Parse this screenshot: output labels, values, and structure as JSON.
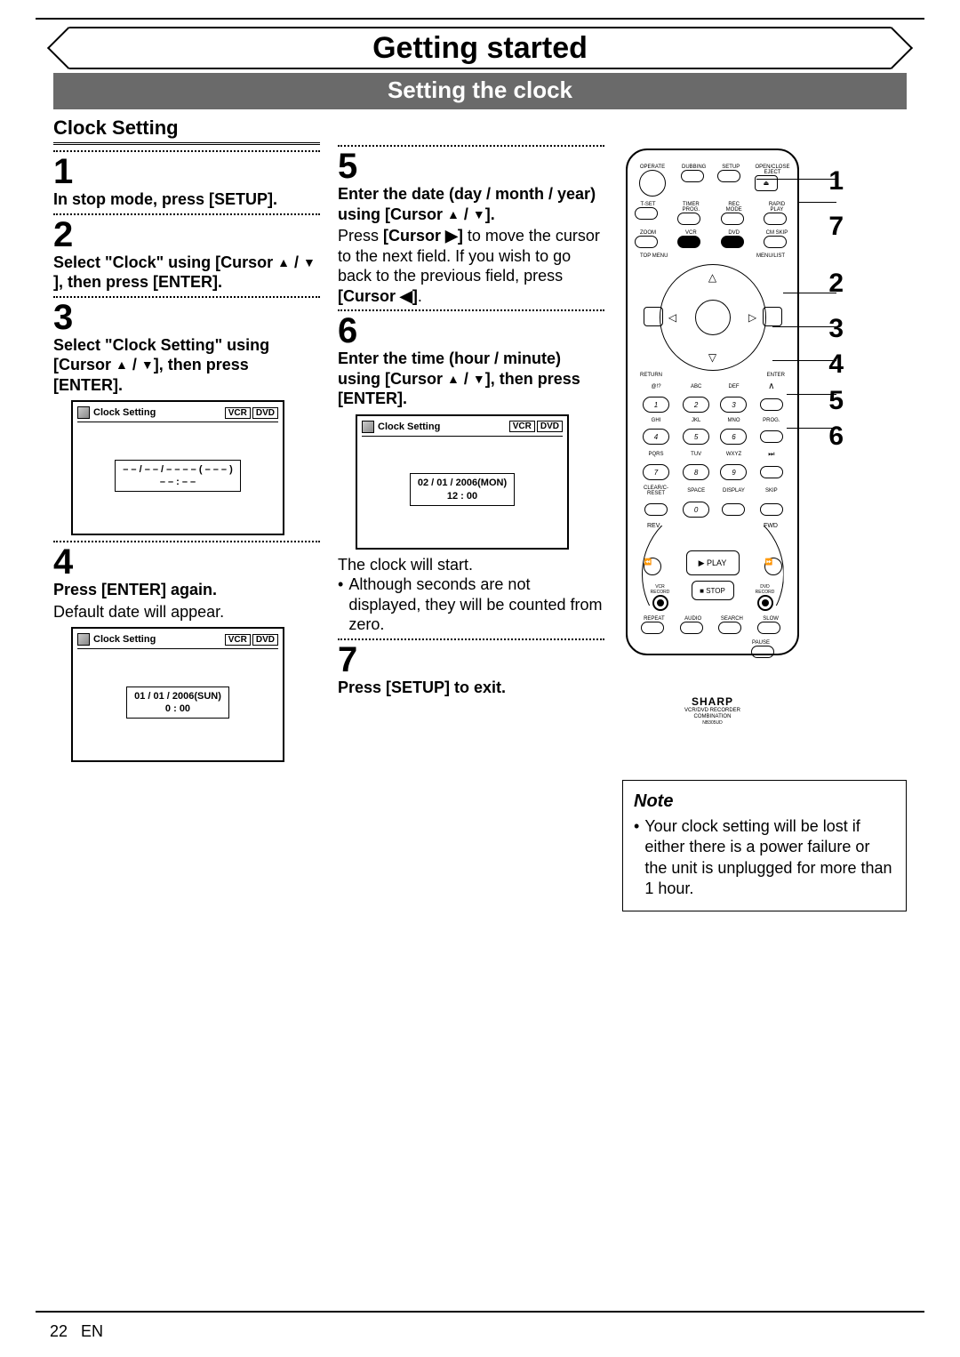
{
  "header": {
    "title": "Getting started",
    "subtitle": "Setting the clock"
  },
  "section_title": "Clock Setting",
  "steps": {
    "s1": {
      "num": "1",
      "bold": "In stop mode, press [SETUP]."
    },
    "s2": {
      "num": "2",
      "bold_a": "Select \"Clock\" using [Cursor ",
      "bold_b": "], then press [ENTER]."
    },
    "s3": {
      "num": "3",
      "bold_a": "Select \"Clock Setting\" using [Cursor ",
      "bold_b": "], then press [ENTER]."
    },
    "s4": {
      "num": "4",
      "bold": "Press [ENTER] again.",
      "body": "Default date will appear."
    },
    "s5": {
      "num": "5",
      "bold_a": "Enter the date (day / month / year) using [Cursor ",
      "bold_b": "].",
      "body_a": "Press ",
      "body_bold_a": "[Cursor ▶]",
      "body_b": " to move the cursor to the next field. If you wish to go back to the previous field, press ",
      "body_bold_b": "[Cursor ◀]",
      "body_c": "."
    },
    "s6": {
      "num": "6",
      "bold_a": "Enter the time (hour / minute) using [Cursor ",
      "bold_b": "], then press [ENTER].",
      "body_a": "The clock will start.",
      "bullet_a": "Although seconds are not displayed, they will be counted from zero."
    },
    "s7": {
      "num": "7",
      "bold": "Press [SETUP] to exit."
    }
  },
  "osd": {
    "title": "Clock Setting",
    "vcr": "VCR",
    "dvd": "DVD",
    "blank_date": "– –  /  – –  / – – – – ( – – – )",
    "blank_time": "– – : – –",
    "date4": "01 / 01 / 2006(SUN)",
    "time4": "0 : 00",
    "date6": "02 / 01 / 2006(MON)",
    "time6": "12 : 00"
  },
  "remote": {
    "row1": [
      "OPERATE",
      "DUBBING",
      "SETUP",
      "OPEN/CLOSE EJECT"
    ],
    "row2": [
      "T-SET",
      "TIMER PROG.",
      "REC MODE",
      "RAPID PLAY"
    ],
    "row3": [
      "ZOOM",
      "VCR",
      "DVD",
      "CM SKIP"
    ],
    "row4": [
      "TOP MENU",
      "",
      "",
      "MENU/LIST"
    ],
    "row5": [
      "RETURN",
      "",
      "",
      "ENTER"
    ],
    "numbers_top": [
      "@!?",
      "ABC",
      "DEF",
      ""
    ],
    "nums1": [
      "1",
      "2",
      "3"
    ],
    "numbers_mid": [
      "GHI",
      "JKL",
      "MNO",
      "PROG."
    ],
    "nums2": [
      "4",
      "5",
      "6"
    ],
    "numbers_bot": [
      "PQRS",
      "TUV",
      "WXYZ",
      ""
    ],
    "nums3": [
      "7",
      "8",
      "9"
    ],
    "row_clear": [
      "CLEAR/C-RESET",
      "SPACE",
      "DISPLAY",
      "SKIP"
    ],
    "nums4": [
      "",
      "0",
      "",
      ""
    ],
    "rev": "REV",
    "fwd": "FWD",
    "play": "▶ PLAY",
    "stop": "■ STOP",
    "vcr_rec": "VCR RECORD",
    "dvd_rec": "DVD RECORD",
    "bottom": [
      "REPEAT",
      "AUDIO",
      "SEARCH",
      "SLOW"
    ],
    "pause": "PAUSE",
    "brand": "SHARP",
    "model_a": "VCR/DVD RECORDER",
    "model_b": "COMBINATION",
    "model_c": "NB305UD"
  },
  "callouts": [
    "1",
    "7",
    "2",
    "3",
    "4",
    "5",
    "6"
  ],
  "note": {
    "title": "Note",
    "body": "Your clock setting will be lost if either there is a power failure or the unit is unplugged for more than 1 hour."
  },
  "page": {
    "num": "22",
    "lang": "EN"
  }
}
